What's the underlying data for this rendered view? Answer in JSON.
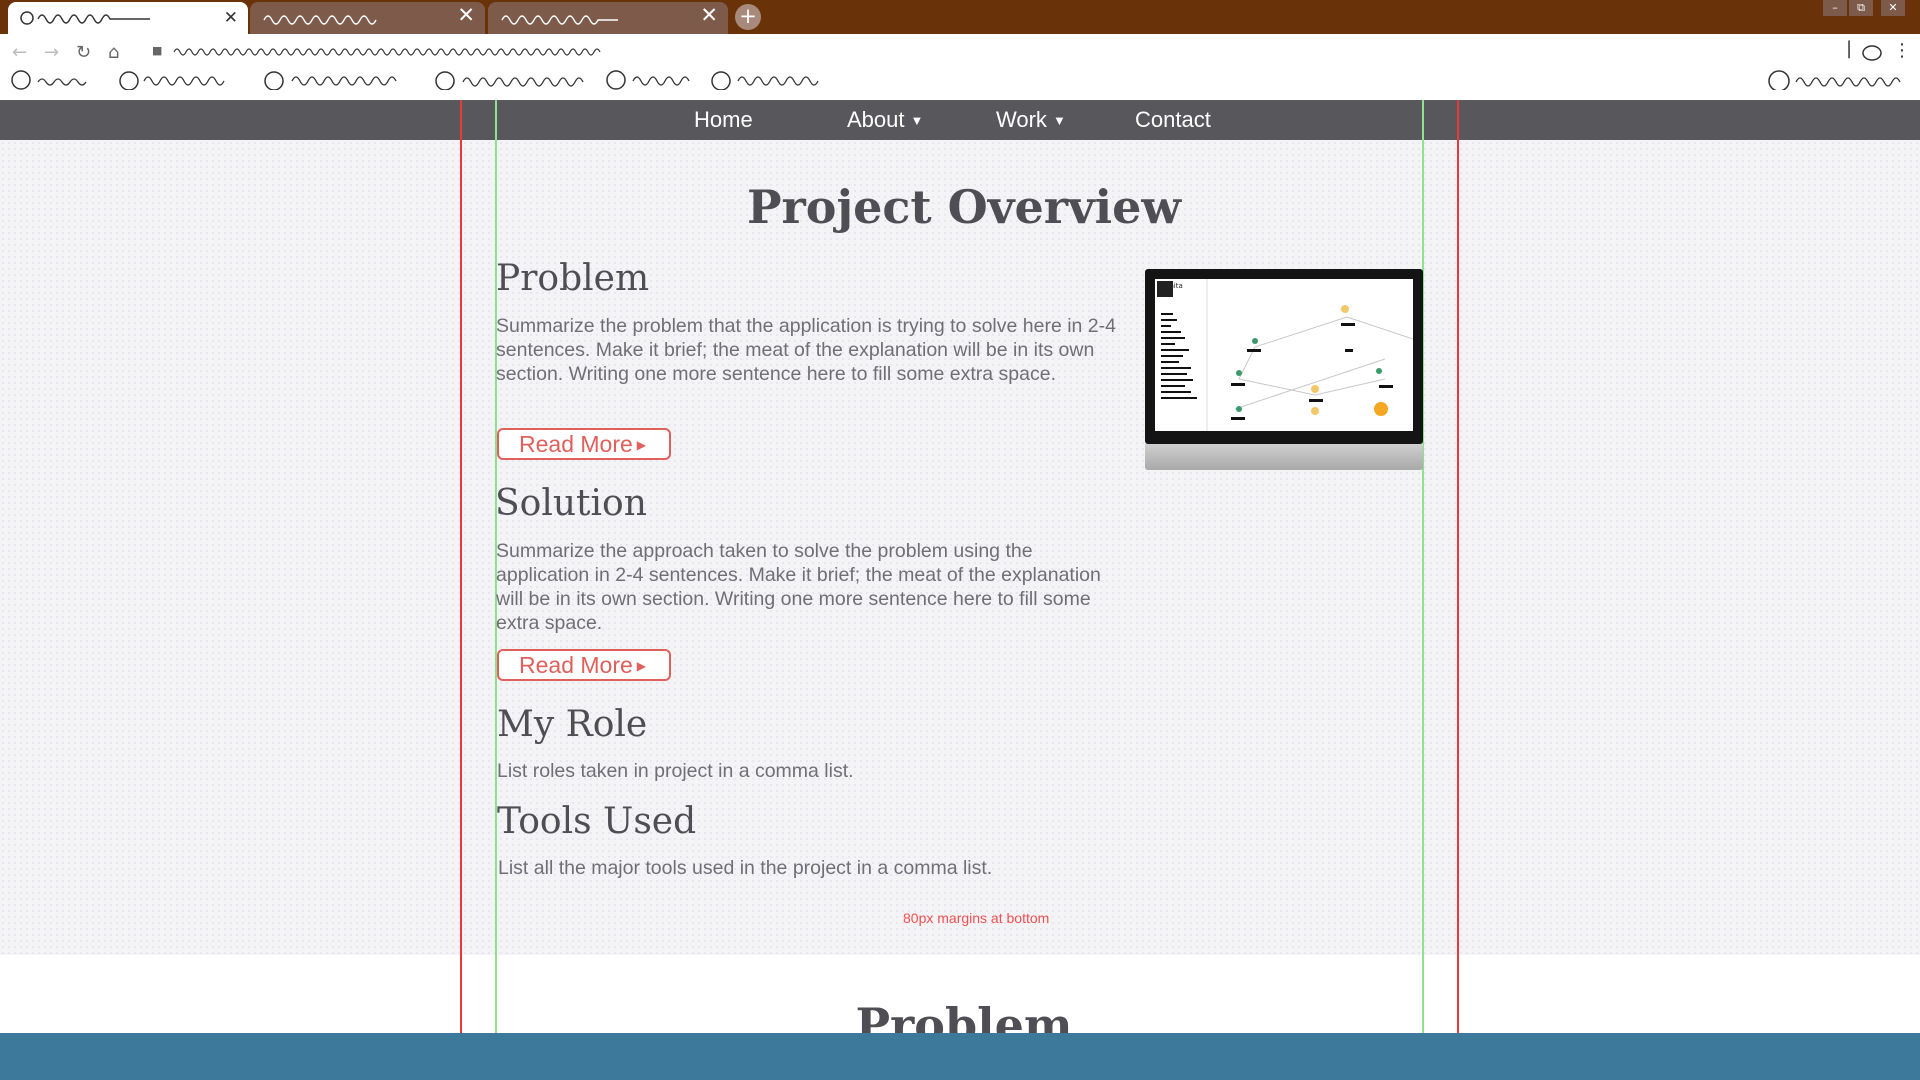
{
  "browser": {
    "window_controls": [
      "–",
      "⧉",
      "✕"
    ],
    "new_tab_label": "+",
    "colors": {
      "tab_bar": "#693209",
      "inactive_tab": "#7d5a4a"
    },
    "icons": [
      "back-icon",
      "forward-icon",
      "reload-icon",
      "home-icon",
      "lock-icon",
      "profile-icon",
      "menu-icon"
    ]
  },
  "nav": {
    "items": [
      {
        "label": "Home"
      },
      {
        "label": "About",
        "caret": "▼"
      },
      {
        "label": "Work",
        "caret": "▼"
      },
      {
        "label": "Contact"
      }
    ]
  },
  "page": {
    "title": "Project Overview",
    "sections": [
      {
        "heading": "Problem",
        "body": "Summarize the problem that the application is trying to solve here in 2-4 sentences. Make it brief; the meat of the explanation will be in its own section. Writing one more sentence here to fill some extra space.",
        "button": "Read More"
      },
      {
        "heading": "Solution",
        "body": "Summarize the approach taken to solve the problem using the application in 2-4 sentences. Make it brief; the meat of the explanation will be in its own section. Writing one more sentence here to fill some extra space.",
        "button": "Read More"
      },
      {
        "heading": "My Role",
        "body": "List roles taken in project in a comma list."
      },
      {
        "heading": "Tools Used",
        "body": "List all the major tools used in the project in a comma list."
      }
    ],
    "button_arrow": "▶",
    "margin_note": "80px margins at bottom",
    "next_section_title": "Problem",
    "monitor_app_name": "Monita",
    "accent_color": "#e0605c",
    "guide_colors": {
      "outer": "#e63a3a",
      "inner": "#8fe08f"
    }
  }
}
